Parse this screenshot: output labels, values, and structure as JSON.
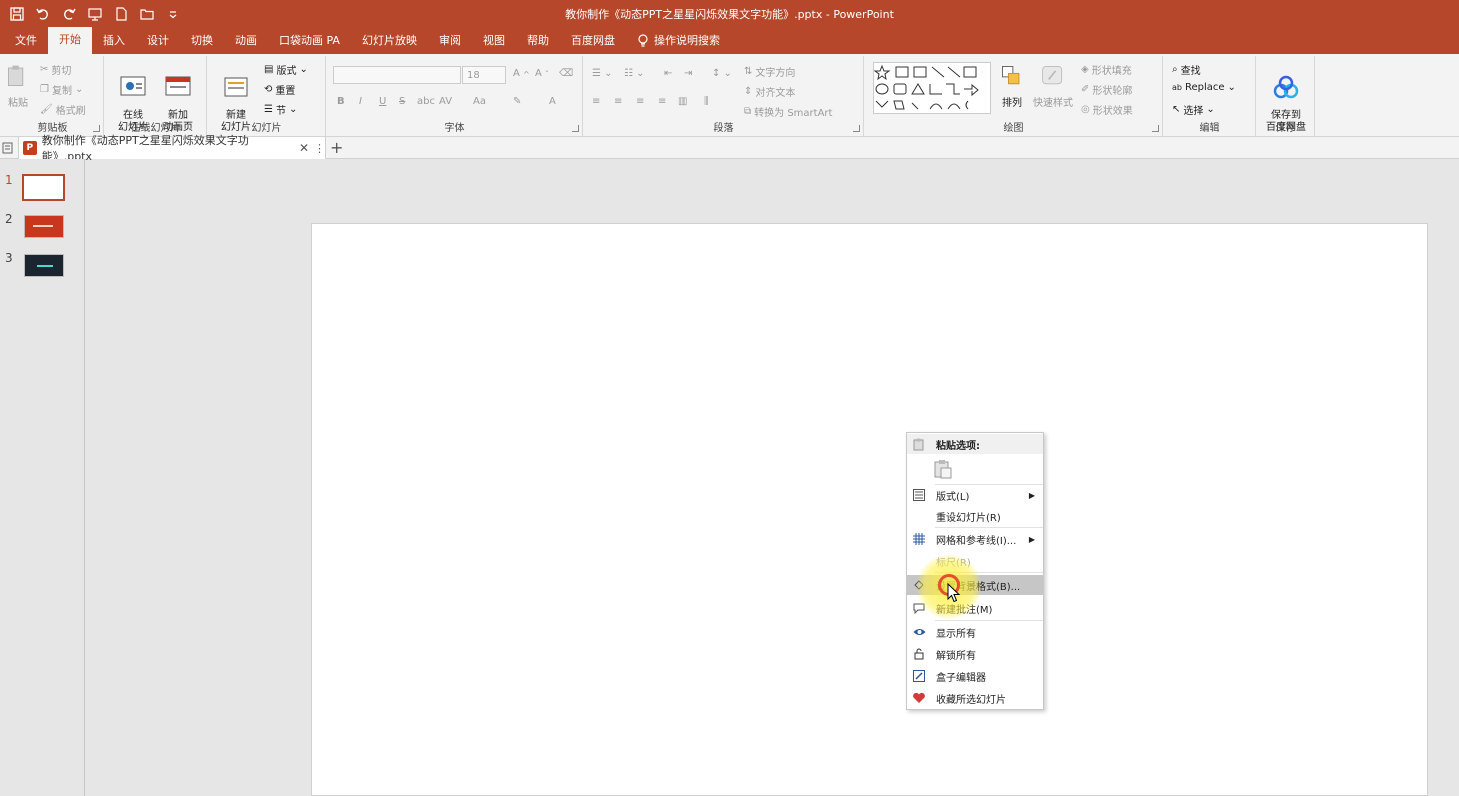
{
  "window": {
    "title": "教你制作《动态PPT之星星闪烁效果文字功能》.pptx - PowerPoint"
  },
  "menu_tabs": [
    {
      "label": "文件"
    },
    {
      "label": "开始",
      "active": true
    },
    {
      "label": "插入"
    },
    {
      "label": "设计"
    },
    {
      "label": "切换"
    },
    {
      "label": "动画"
    },
    {
      "label": "口袋动画 PA"
    },
    {
      "label": "幻灯片放映"
    },
    {
      "label": "审阅"
    },
    {
      "label": "视图"
    },
    {
      "label": "帮助"
    },
    {
      "label": "百度网盘"
    },
    {
      "label": "操作说明搜索",
      "icon": "lightbulb-icon"
    }
  ],
  "ribbon": {
    "clipboard": {
      "paste": "粘贴",
      "cut": "剪切",
      "copy": "复制",
      "format_painter": "格式刷",
      "label": "剪贴板"
    },
    "online_slides": {
      "online_slide": "在线\n幻灯片",
      "new_anim_page": "新加\n动画页",
      "label": "在线幻灯片"
    },
    "slides": {
      "new_slide": "新建\n幻灯片",
      "layout": "版式",
      "reset": "重置",
      "section": "节",
      "label": "幻灯片"
    },
    "font": {
      "font_size": "18",
      "bold": "B",
      "italic": "I",
      "underline": "U",
      "strike": "S",
      "abc": "abc",
      "av": "AV",
      "aa": "Aa",
      "a": "A",
      "label": "字体"
    },
    "paragraph": {
      "text_direction": "文字方向",
      "align_text": "对齐文本",
      "smartart": "转换为 SmartArt",
      "label": "段落"
    },
    "drawing": {
      "arrange": "排列",
      "quick_styles": "快速样式",
      "fill": "形状填充",
      "outline": "形状轮廓",
      "effect": "形状效果",
      "label": "绘图"
    },
    "editing": {
      "find": "查找",
      "replace": "Replace",
      "select": "选择",
      "label": "编辑"
    },
    "save": {
      "save_baidu": "保存到\n百度网盘",
      "label": "保存"
    }
  },
  "document_tab": {
    "title": "教你制作《动态PPT之星星闪烁效果文字功能》.pptx"
  },
  "thumbnails": [
    {
      "number": "1",
      "selected": true,
      "color": "#ffffff"
    },
    {
      "number": "2",
      "selected": false,
      "color": "#c8371d"
    },
    {
      "number": "3",
      "selected": false,
      "color": "#1b2530"
    }
  ],
  "context_menu": {
    "paste_options": "粘贴选项:",
    "items": [
      {
        "label": "版式(L)",
        "icon": "layout-icon",
        "submenu": true,
        "disabled": false
      },
      {
        "label": "重设幻灯片(R)",
        "icon": "",
        "submenu": false,
        "disabled": false
      },
      {
        "label": "网格和参考线(I)...",
        "icon": "grid-icon",
        "submenu": true,
        "disabled": false
      },
      {
        "label": "标尺(R)",
        "icon": "",
        "submenu": false,
        "disabled": true
      },
      {
        "label": "设置背景格式(B)...",
        "icon": "background-format-icon",
        "submenu": false,
        "disabled": false,
        "highlighted": true
      },
      {
        "label": "新建批注(M)",
        "icon": "comment-icon",
        "submenu": false,
        "disabled": false
      },
      {
        "label": "显示所有",
        "icon": "eye-icon",
        "submenu": false,
        "disabled": false
      },
      {
        "label": "解锁所有",
        "icon": "unlock-icon",
        "submenu": false,
        "disabled": false
      },
      {
        "label": "盒子编辑器",
        "icon": "editor-icon",
        "submenu": false,
        "disabled": false
      },
      {
        "label": "收藏所选幻灯片",
        "icon": "heart-icon",
        "submenu": false,
        "disabled": false
      }
    ]
  },
  "colors": {
    "accent": "#b7472a",
    "ribbon_bg": "#f3f3f3",
    "workspace": "#e6e6e6"
  }
}
